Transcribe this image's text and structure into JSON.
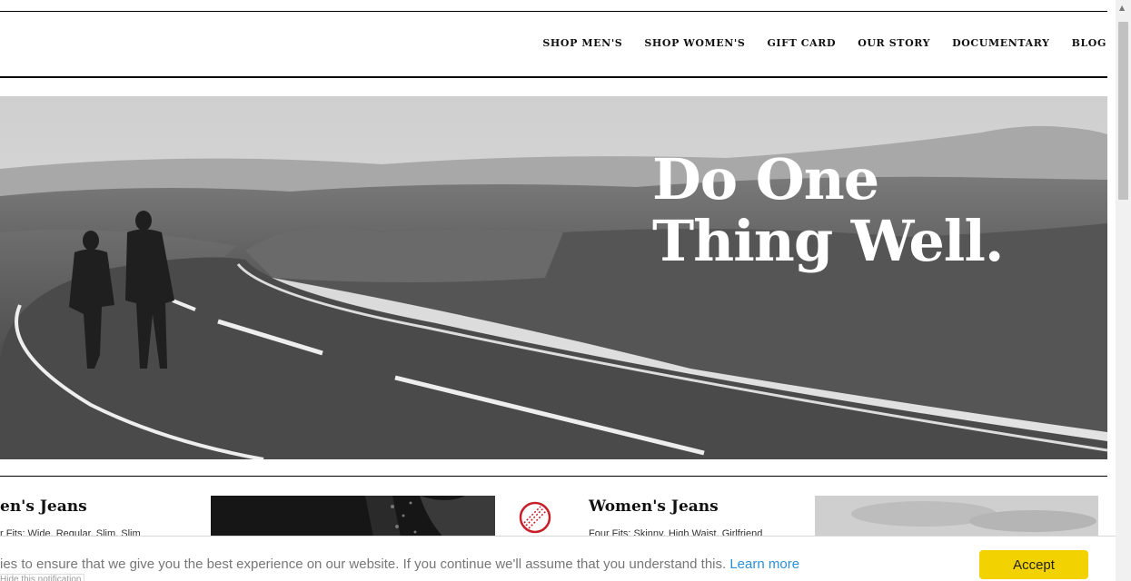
{
  "nav": {
    "items": [
      {
        "label": "SHOP MEN'S"
      },
      {
        "label": "SHOP WOMEN'S"
      },
      {
        "label": "GIFT CARD"
      },
      {
        "label": "OUR STORY"
      },
      {
        "label": "DOCUMENTARY"
      },
      {
        "label": "BLOG"
      }
    ]
  },
  "hero": {
    "line1": "Do One",
    "line2": "Thing Well."
  },
  "products": [
    {
      "title": "en's Jeans",
      "desc": "r Fits: Wide, Regular, Slim, Slim"
    },
    {
      "title": "Women's Jeans",
      "desc": "Four Fits: Skinny, High Waist, Girlfriend"
    }
  ],
  "cookie": {
    "text": "ies to ensure that we give you the best experience on our website. If you continue we'll assume that you understand this.",
    "link": "Learn more",
    "accept": "Accept",
    "sub": "Hide this notification"
  },
  "icons": {
    "badge": "cricket-ball-icon"
  },
  "colors": {
    "accept_button": "#f2d200",
    "link": "#2b8fd6",
    "badge": "#c8202a"
  }
}
